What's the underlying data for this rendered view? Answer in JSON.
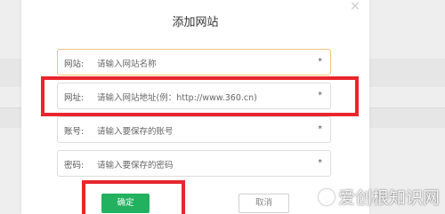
{
  "dialog": {
    "title": "添加网站",
    "close_icon": "×",
    "fields": [
      {
        "label": "网站:",
        "placeholder": "请输入网站名称",
        "required_mark": "*"
      },
      {
        "label": "网址:",
        "placeholder": "请输入网站地址(例：http://www.360.cn)",
        "required_mark": "*"
      },
      {
        "label": "账号:",
        "placeholder": "请输入要保存的账号",
        "required_mark": "*"
      },
      {
        "label": "密码:",
        "placeholder": "请输入要保存的密码",
        "required_mark": "*"
      }
    ],
    "confirm_label": "确定",
    "cancel_label": "取消"
  },
  "watermark": {
    "text": "爱创根知识网"
  },
  "colors": {
    "accent_green": "#22b15e",
    "highlight_red": "#e8262d",
    "focus_border": "#f0c37a"
  }
}
